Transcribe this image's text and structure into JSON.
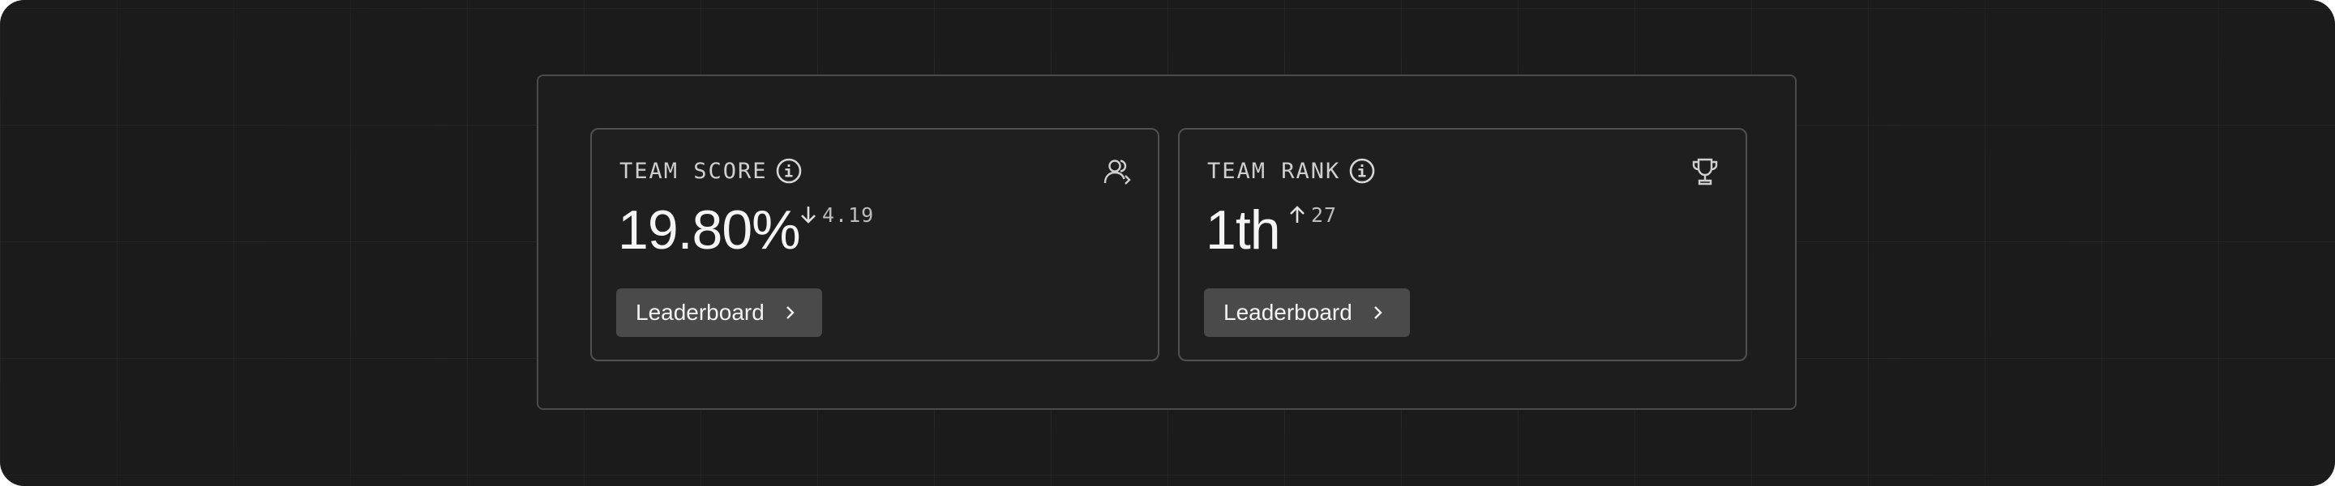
{
  "cards": [
    {
      "label": "TEAM SCORE",
      "value": "19.80%",
      "delta": "4.19",
      "delta_direction": "down",
      "corner_icon": "users-icon",
      "button_label": "Leaderboard"
    },
    {
      "label": "TEAM RANK",
      "value": "1th",
      "delta": "27",
      "delta_direction": "up",
      "corner_icon": "trophy-icon",
      "button_label": "Leaderboard"
    }
  ],
  "colors": {
    "background": "#1b1b1b",
    "card_border": "#505050",
    "button_bg": "#4a4a4a",
    "text": "#f4f4f4"
  }
}
